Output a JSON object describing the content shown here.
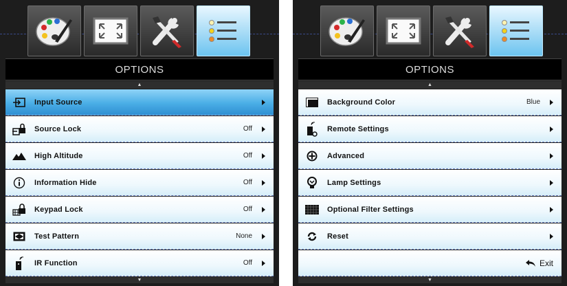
{
  "left_panel": {
    "title": "OPTIONS",
    "tabs": [
      {
        "icon": "palette-icon"
      },
      {
        "icon": "screen-resize-icon"
      },
      {
        "icon": "tools-icon"
      },
      {
        "icon": "options-list-icon",
        "active": true
      }
    ],
    "items": [
      {
        "label": "Input Source",
        "value": "",
        "icon": "input-source-icon",
        "selected": true
      },
      {
        "label": "Source Lock",
        "value": "Off",
        "icon": "source-lock-icon"
      },
      {
        "label": "High Altitude",
        "value": "Off",
        "icon": "high-altitude-icon"
      },
      {
        "label": "Information Hide",
        "value": "Off",
        "icon": "info-icon"
      },
      {
        "label": "Keypad Lock",
        "value": "Off",
        "icon": "keypad-lock-icon"
      },
      {
        "label": "Test Pattern",
        "value": "None",
        "icon": "test-pattern-icon"
      },
      {
        "label": "IR Function",
        "value": "Off",
        "icon": "ir-remote-icon"
      }
    ]
  },
  "right_panel": {
    "title": "OPTIONS",
    "tabs": [
      {
        "icon": "palette-icon"
      },
      {
        "icon": "screen-resize-icon"
      },
      {
        "icon": "tools-icon"
      },
      {
        "icon": "options-list-icon",
        "active": true
      }
    ],
    "items": [
      {
        "label": "Background Color",
        "value": "Blue",
        "icon": "background-color-icon"
      },
      {
        "label": "Remote Settings",
        "value": "",
        "icon": "remote-settings-icon"
      },
      {
        "label": "Advanced",
        "value": "",
        "icon": "advanced-icon"
      },
      {
        "label": "Lamp Settings",
        "value": "",
        "icon": "lamp-icon"
      },
      {
        "label": "Optional Filter Settings",
        "value": "",
        "icon": "filter-icon"
      },
      {
        "label": "Reset",
        "value": "",
        "icon": "reset-icon"
      }
    ],
    "exit_label": "Exit"
  },
  "colors": {
    "selected_row": "#4aaee6",
    "active_tab": "#9fd8f5",
    "panel_bg": "#1d1d1d"
  }
}
